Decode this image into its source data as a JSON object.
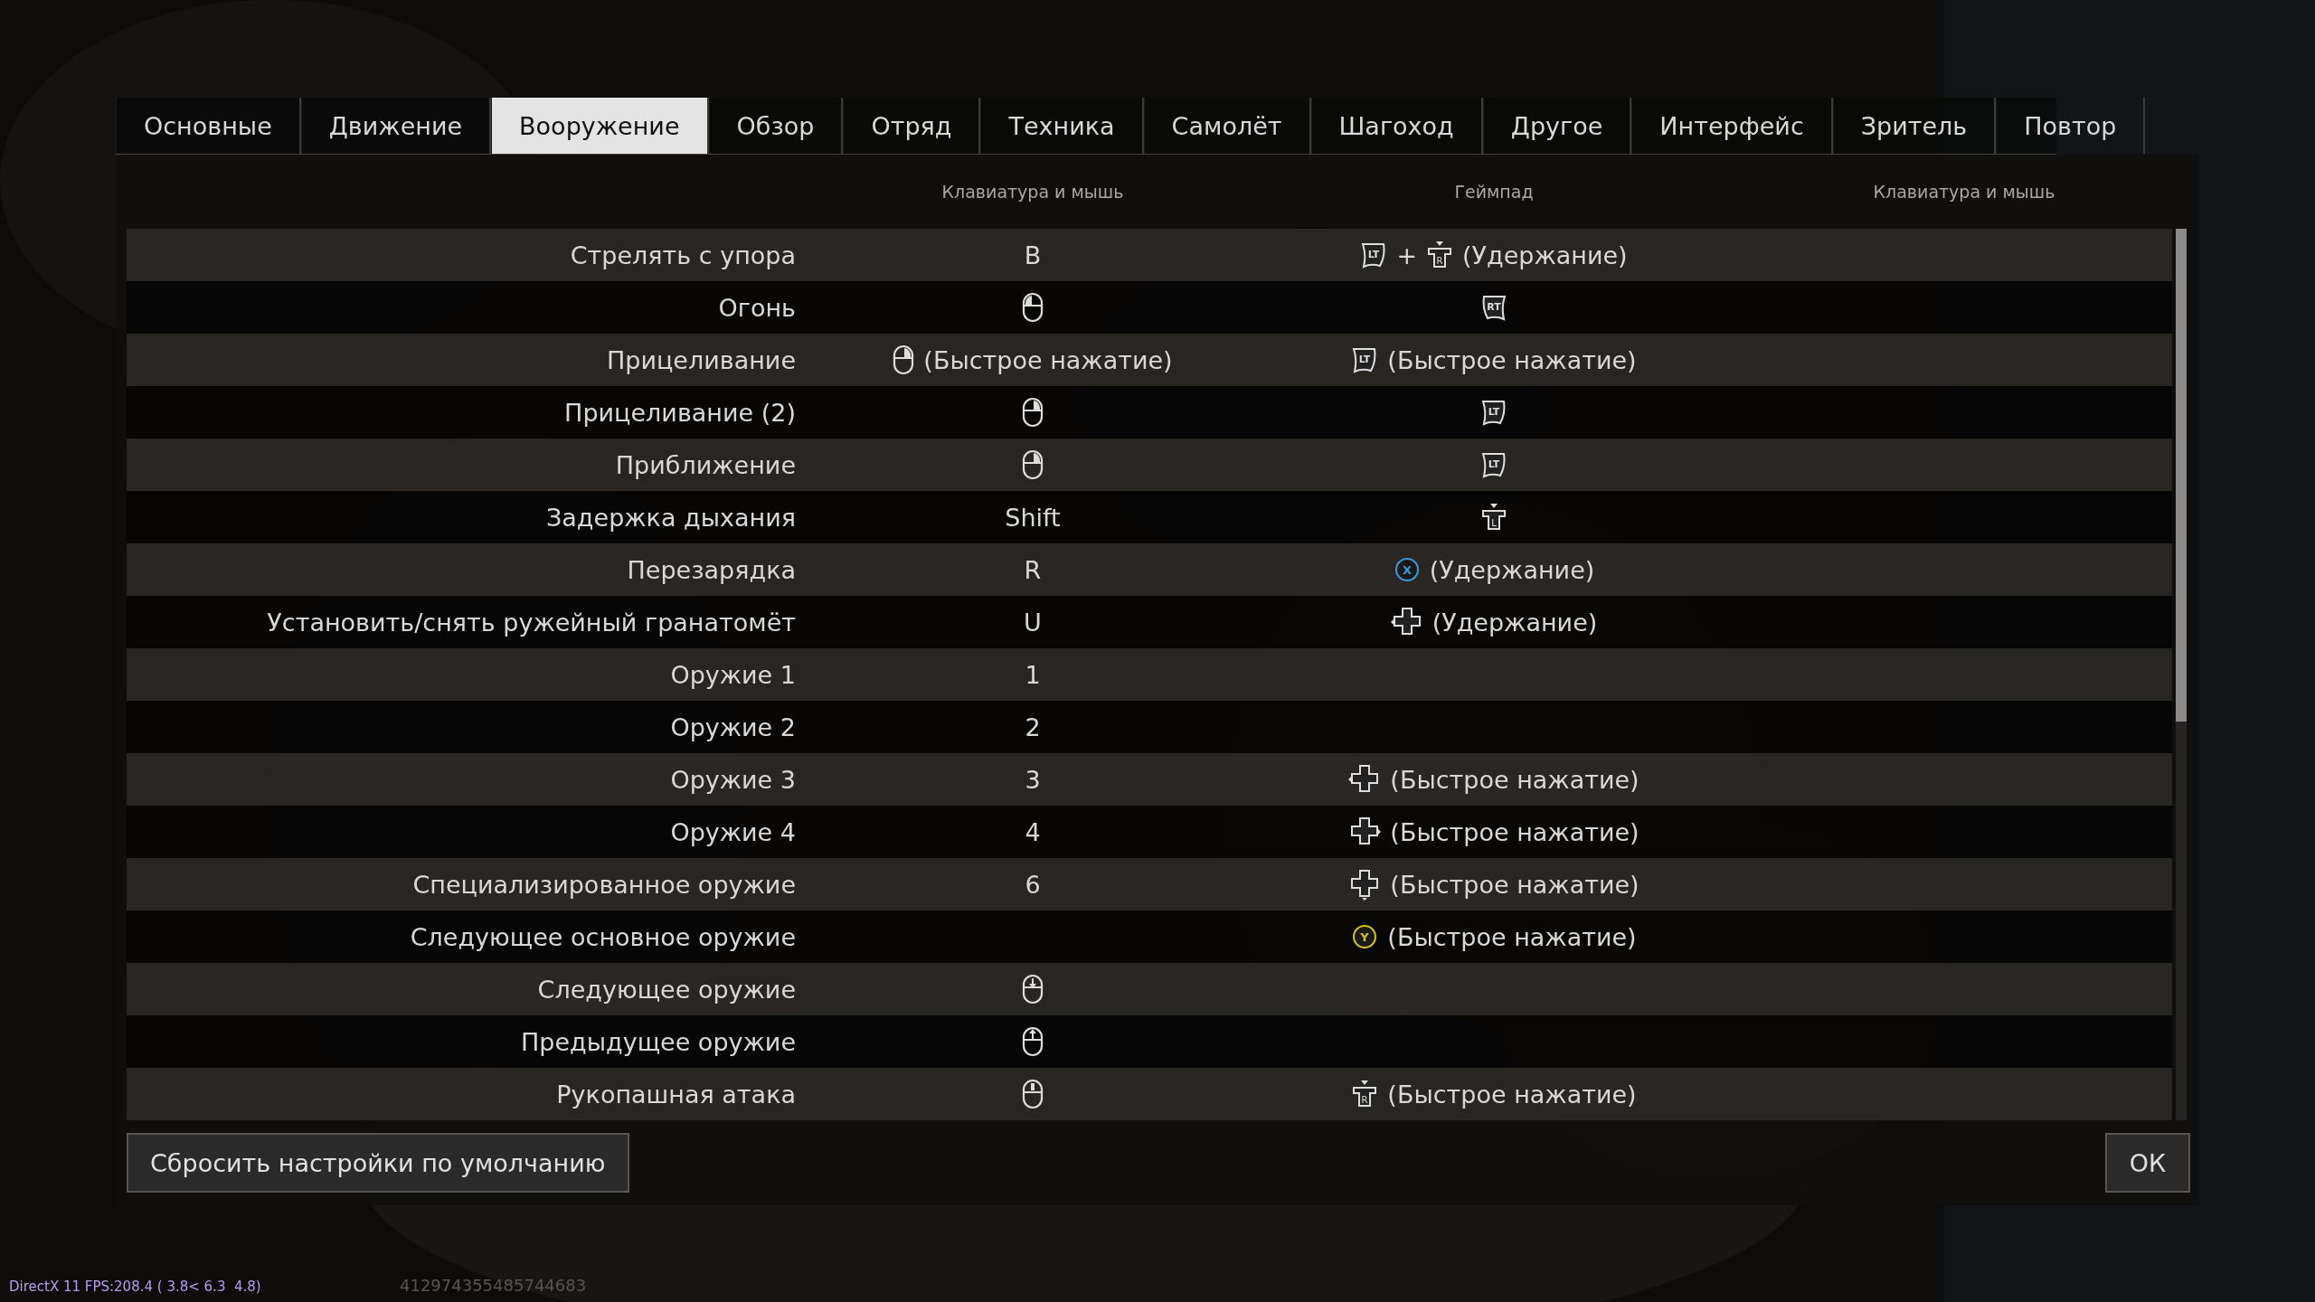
{
  "tabs": [
    {
      "label": "Основные",
      "selected": false
    },
    {
      "label": "Движение",
      "selected": false
    },
    {
      "label": "Вооружение",
      "selected": true
    },
    {
      "label": "Обзор",
      "selected": false
    },
    {
      "label": "Отряд",
      "selected": false
    },
    {
      "label": "Техника",
      "selected": false
    },
    {
      "label": "Самолёт",
      "selected": false
    },
    {
      "label": "Шагоход",
      "selected": false
    },
    {
      "label": "Другое",
      "selected": false
    },
    {
      "label": "Интерфейс",
      "selected": false
    },
    {
      "label": "Зритель",
      "selected": false
    },
    {
      "label": "Повтор",
      "selected": false
    }
  ],
  "table": {
    "columns": [
      "Клавиатура и мышь",
      "Геймпад",
      "Клавиатура и мышь"
    ],
    "rows": [
      {
        "label": "Стрелять с упора",
        "keyboard": [
          {
            "kind": "text",
            "text": "B"
          }
        ],
        "gamepad": [
          {
            "kind": "trigger-left",
            "label": "LT"
          },
          {
            "kind": "text",
            "text": "+"
          },
          {
            "kind": "stick",
            "label": "R"
          },
          {
            "kind": "text",
            "text": "(Удержание)"
          }
        ]
      },
      {
        "label": "Огонь",
        "keyboard": [
          {
            "kind": "mouse-left"
          }
        ],
        "gamepad": [
          {
            "kind": "trigger-right",
            "label": "RT"
          }
        ]
      },
      {
        "label": "Прицеливание",
        "keyboard": [
          {
            "kind": "mouse-right"
          },
          {
            "kind": "text",
            "text": "(Быстрое нажатие)"
          }
        ],
        "gamepad": [
          {
            "kind": "trigger-left",
            "label": "LT"
          },
          {
            "kind": "text",
            "text": "(Быстрое нажатие)"
          }
        ]
      },
      {
        "label": "Прицеливание (2)",
        "keyboard": [
          {
            "kind": "mouse-right"
          }
        ],
        "gamepad": [
          {
            "kind": "trigger-left",
            "label": "LT"
          }
        ]
      },
      {
        "label": "Приближение",
        "keyboard": [
          {
            "kind": "mouse-right"
          }
        ],
        "gamepad": [
          {
            "kind": "trigger-left",
            "label": "LT"
          }
        ]
      },
      {
        "label": "Задержка дыхания",
        "keyboard": [
          {
            "kind": "text",
            "text": "Shift"
          }
        ],
        "gamepad": [
          {
            "kind": "stick",
            "label": "L"
          }
        ]
      },
      {
        "label": "Перезарядка",
        "keyboard": [
          {
            "kind": "text",
            "text": "R"
          }
        ],
        "gamepad": [
          {
            "kind": "face-button",
            "label": "X",
            "color": "#3a9ad9"
          },
          {
            "kind": "text",
            "text": "(Удержание)"
          }
        ]
      },
      {
        "label": "Установить/снять ружейный гранатомёт",
        "keyboard": [
          {
            "kind": "text",
            "text": "U"
          }
        ],
        "gamepad": [
          {
            "kind": "dpad-left"
          },
          {
            "kind": "text",
            "text": "(Удержание)"
          }
        ]
      },
      {
        "label": "Оружие 1",
        "keyboard": [
          {
            "kind": "text",
            "text": "1"
          }
        ]
      },
      {
        "label": "Оружие 2",
        "keyboard": [
          {
            "kind": "text",
            "text": "2"
          }
        ]
      },
      {
        "label": "Оружие 3",
        "keyboard": [
          {
            "kind": "text",
            "text": "3"
          }
        ],
        "gamepad": [
          {
            "kind": "dpad-left"
          },
          {
            "kind": "text",
            "text": "(Быстрое нажатие)"
          }
        ]
      },
      {
        "label": "Оружие 4",
        "keyboard": [
          {
            "kind": "text",
            "text": "4"
          }
        ],
        "gamepad": [
          {
            "kind": "dpad-right"
          },
          {
            "kind": "text",
            "text": "(Быстрое нажатие)"
          }
        ]
      },
      {
        "label": "Специализированное оружие",
        "keyboard": [
          {
            "kind": "text",
            "text": "6"
          }
        ],
        "gamepad": [
          {
            "kind": "dpad-down"
          },
          {
            "kind": "text",
            "text": "(Быстрое нажатие)"
          }
        ]
      },
      {
        "label": "Следующее основное оружие",
        "gamepad": [
          {
            "kind": "face-button",
            "label": "Y",
            "color": "#d4c21a"
          },
          {
            "kind": "text",
            "text": "(Быстрое нажатие)"
          }
        ]
      },
      {
        "label": "Следующее оружие",
        "keyboard": [
          {
            "kind": "mouse-wheel-down"
          }
        ]
      },
      {
        "label": "Предыдущее оружие",
        "keyboard": [
          {
            "kind": "mouse-wheel-up"
          }
        ]
      },
      {
        "label": "Рукопашная атака",
        "keyboard": [
          {
            "kind": "mouse-middle"
          }
        ],
        "gamepad": [
          {
            "kind": "stick",
            "label": "R"
          },
          {
            "kind": "text",
            "text": "(Быстрое нажатие)"
          }
        ]
      }
    ]
  },
  "buttons": {
    "reset": "Сбросить настройки по умолчанию",
    "ok": "ОК"
  },
  "status_bar": {
    "stats": "DirectX 11 FPS:208.4 ( 3.8< 6.3  4.8)",
    "id": "412974355485744683"
  }
}
